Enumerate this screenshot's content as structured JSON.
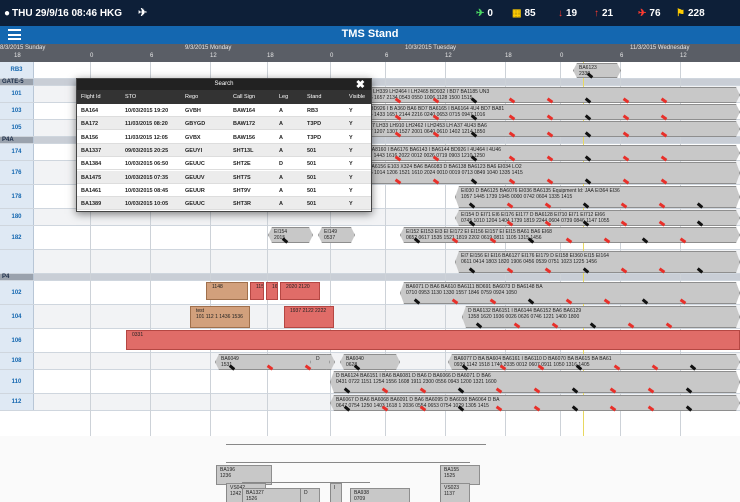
{
  "status_bar": {
    "datetime": "THU 29/9/16 08:46 HKG",
    "plane_icon": "airplane-icon",
    "counters": [
      {
        "icon": "green-plane-icon",
        "value": "0",
        "color": "#4cd964"
      },
      {
        "icon": "yellow-stand-icon",
        "value": "85",
        "color": "#ffcc00"
      },
      {
        "icon": "red-arrival-icon",
        "value": "19",
        "color": "#ff3b30"
      },
      {
        "icon": "red-departure-icon",
        "value": "21",
        "color": "#ff3b30"
      },
      {
        "icon": "red-alert-icon",
        "value": "76",
        "color": "#ff3b30"
      },
      {
        "icon": "yellow-flag-icon",
        "value": "228",
        "color": "#ffcc00"
      }
    ]
  },
  "nav": {
    "title": "TMS Stand",
    "menu_icon": "hamburger-menu-icon"
  },
  "timeline": {
    "dates": [
      "8/3/2015 Sunday",
      "9/3/2015 Monday",
      "10/3/2015 Tuesday",
      "11/3/2015 Wednesday"
    ],
    "ticks": [
      "18",
      "0",
      "6",
      "12",
      "18",
      "0",
      "6",
      "12",
      "18",
      "0",
      "6",
      "12"
    ]
  },
  "stands": [
    {
      "label": "RB3",
      "type": "stand",
      "alt": false
    },
    {
      "label": "GATE-5",
      "type": "group"
    },
    {
      "label": "101",
      "type": "stand",
      "alt": true
    },
    {
      "label": "103",
      "type": "stand",
      "alt": false
    },
    {
      "label": "105",
      "type": "stand",
      "alt": true
    },
    {
      "label": "P4A",
      "type": "group"
    },
    {
      "label": "174",
      "type": "stand",
      "alt": false
    },
    {
      "label": "176",
      "type": "stand",
      "alt": true
    },
    {
      "label": "178",
      "type": "stand",
      "alt": false
    },
    {
      "label": "180",
      "type": "stand",
      "alt": true
    },
    {
      "label": "182",
      "type": "stand",
      "alt": false
    },
    {
      "label": "",
      "type": "stand",
      "alt": true
    },
    {
      "label": "P4",
      "type": "group"
    },
    {
      "label": "102",
      "type": "stand",
      "alt": false
    },
    {
      "label": "104",
      "type": "stand",
      "alt": true
    },
    {
      "label": "106",
      "type": "stand",
      "alt": false
    },
    {
      "label": "108",
      "type": "stand",
      "alt": true
    },
    {
      "label": "110",
      "type": "stand",
      "alt": false
    },
    {
      "label": "112",
      "type": "stand",
      "alt": true
    }
  ],
  "flights": [
    {
      "label": "BA6123\n2330",
      "color": "gray"
    },
    {
      "label": "BA6149 D LH339 LH2464 I LH2465 BD932 I BD7 BA1185 UN3\n0824 0526 1657 2134 0543 0550 1006 1128 1500 1515",
      "color": "gray"
    },
    {
      "label": "TP353 D BD926 I B A360 BA6 BD7 BA6165 I BA6164 4U4 BD7 BA81\n0730 0944 1433 1651 2144 2216 0240 0653 0715 0947 1016",
      "color": "gray"
    },
    {
      "label": "BA6 BA677 LH33 LH910 LH2462 I LH2453 LH A37 4U43 BA6\n0617 0637 1207 1307 1527 2001 0640 0610 1402 1214 1850",
      "color": "gray"
    },
    {
      "label": "BD934 I BA8160 I BA6176 BA6143 I BA6144 BD926 I 4U464 I 4U46\n0755 1152 1443 1616 2022 0012 0026 0719 0903 1210 1250",
      "color": "gray"
    },
    {
      "label": "BA6144 BA6156 E103 X324 BA6 BA6083 D BA6138 BA6123 BA6 EI034 LO2\n0402 0616 1014 1206 1521 1610 2024 0010 0019 0713 0849 1040 1335 1415",
      "color": "gray"
    },
    {
      "label": "EI030 D BA6125 BA6076 EI036 BA6135 Equipment Id: JAA EI364 EI36\n1057 1445 1739 1945 0000 0742 0604 1335 1415",
      "color": "gray"
    },
    {
      "label": "EI154 D EI71 EI6 EI176 EI177 D BA6128 EI710 EI71 EI712 EI66\n0745 1010 1204 1404 1739 1819 2244 0604 0739 0846 1147 1055",
      "color": "gray"
    },
    {
      "label": "EI154\n2015",
      "color": "gray"
    },
    {
      "label": "EI149\n0537",
      "color": "gray"
    },
    {
      "label": "EI152 EI153 EI3 EI EI172 EI EI156 EI157 EI EI15 BA61 BA6 EI68\n0652 0617 1535 1521 1819 2202 0619 0811 1105 1315 1456",
      "color": "gray"
    },
    {
      "label": "EI7 EI156 EI EI16 BA6127 EI176 EI179 D EI158 EI360 EI15 EI164\n0611 0414 1803 1820 1906 0456 0539 0751 1023 1225 1456",
      "color": "gray"
    },
    {
      "label": "1148",
      "color": "brown"
    },
    {
      "label": "1150",
      "color": "red"
    },
    {
      "label": "1625 1606 1",
      "color": "red"
    },
    {
      "label": "2020 2120",
      "color": "red"
    },
    {
      "label": "BA6071 D BA6 BA610 BA6111 BD691 BA6073 D BA6148 BA\n0710 0953 1130 1330 1557 1846 0759 0924 1050",
      "color": "gray"
    },
    {
      "label": "test\n101 112 1 1436 1536",
      "color": "brown"
    },
    {
      "label": "1937 2122 2222",
      "color": "red"
    },
    {
      "label": "D BA6132 BA6151 I BA6144 BA6152 BA6 BA6129\n1358 1620 1936 0026 0626 0746 1221 1400 1800",
      "color": "gray"
    },
    {
      "label": "0331",
      "color": "red"
    },
    {
      "label": "BA6049\n1531",
      "color": "gray"
    },
    {
      "label": "D",
      "color": "gray"
    },
    {
      "label": "BA6040\n0628",
      "color": "gray"
    },
    {
      "label": "BA6077 D BA BA604 BA6161 I BA6110 D BA6070 BA BA615 BA BA61\n0939 1142 1518 1740 2035 0012 0607 0911 1050 1316 1405",
      "color": "gray"
    },
    {
      "label": "D BA6124 BA6151 I BA6 BA6081 D BA6 D BA6066 D BA6071 D BA6\n0431 0722 1151 1254 1556 1608 1911 2300 0556 0943 1200 1321 1600",
      "color": "gray"
    },
    {
      "label": "BA6067 D BA6 BA6068 BA6091 D BA6 BA6095 D BA6038 BA6064 D BA\n0647 0754 1250 1403 1618 1 2036 0554 0653 0754 1029 1305 1415",
      "color": "gray"
    },
    {
      "label": "BA196\n1236",
      "color": "gray"
    },
    {
      "label": "BA155\n1525",
      "color": "gray"
    },
    {
      "label": "VS042\n1242",
      "color": "gray"
    },
    {
      "label": "I",
      "color": "gray"
    },
    {
      "label": "VS023\n1137",
      "color": "gray"
    },
    {
      "label": "BA1327\n1526",
      "color": "gray"
    },
    {
      "label": "D",
      "color": "gray"
    },
    {
      "label": "BA938\n0709",
      "color": "gray"
    }
  ],
  "search_popup": {
    "title": "Search",
    "close_icon": "close-x-icon",
    "columns": [
      "Flight Id",
      "STO",
      "Rego",
      "Call Sign",
      "Leg",
      "Stand",
      "Visible"
    ],
    "rows": [
      [
        "BA164",
        "10/03/2015 19:20",
        "GVBH",
        "BAW164",
        "A",
        "RB3",
        "Y"
      ],
      [
        "BA172",
        "11/03/2015 08:20",
        "GBYGD",
        "BAW172",
        "A",
        "T3PD",
        "Y"
      ],
      [
        "BA156",
        "11/03/2015 12:05",
        "GVBX",
        "BAW156",
        "A",
        "T3PD",
        "Y"
      ],
      [
        "BA1337",
        "09/03/2015 20:25",
        "GEUYI",
        "SHT13L",
        "A",
        "501",
        "Y"
      ],
      [
        "BA1384",
        "10/03/2015 06:50",
        "GEUUC",
        "SHT2E",
        "D",
        "501",
        "Y"
      ],
      [
        "BA1475",
        "10/03/2015 07:35",
        "GEUUV",
        "SHT7S",
        "A",
        "501",
        "Y"
      ],
      [
        "BA1461",
        "10/03/2015 08:45",
        "GEUUR",
        "SHT9V",
        "A",
        "501",
        "Y"
      ],
      [
        "BA1389",
        "10/03/2015 10:05",
        "GEUUC",
        "SHT3R",
        "A",
        "501",
        "Y"
      ]
    ]
  }
}
